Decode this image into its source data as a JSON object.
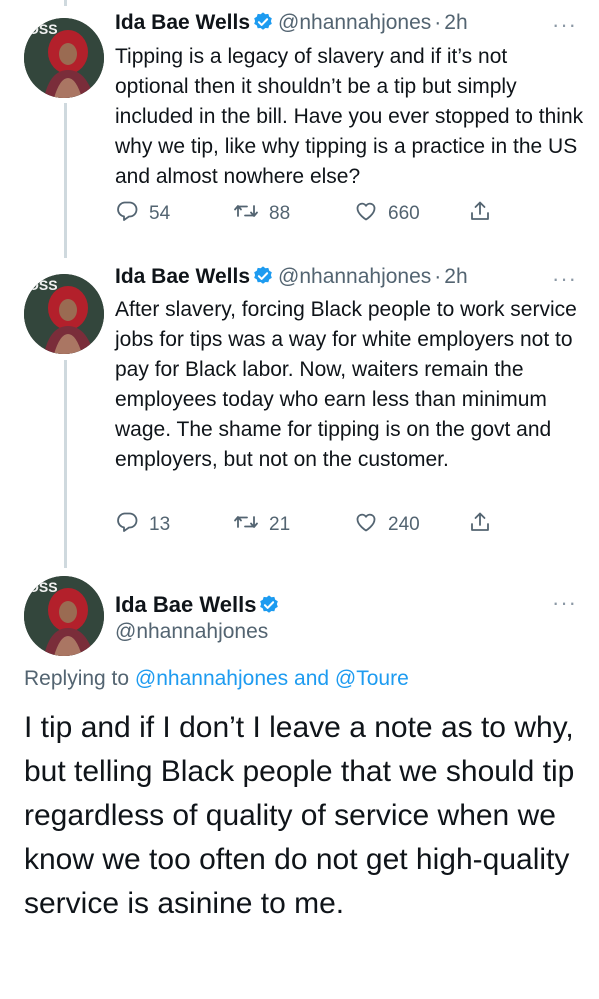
{
  "tweets": [
    {
      "name": "Ida Bae Wells",
      "handle": "@nhannahjones",
      "dot": "·",
      "time": "2h",
      "more": "···",
      "text": "Tipping is a legacy of slavery and if it’s not optional then it shouldn’t be a tip but simply included in the bill. Have you ever stopped to think why we tip, like why tipping is a practice in the US and almost nowhere else?",
      "replies": "54",
      "retweets": "88",
      "likes": "660"
    },
    {
      "name": "Ida Bae Wells",
      "handle": "@nhannahjones",
      "dot": "·",
      "time": "2h",
      "more": "···",
      "text": "After slavery, forcing Black people to work service jobs for tips was a way for white employers not to pay for Black labor. Now, waiters remain the employees today who earn less than minimum wage. The shame for tipping is on the govt and employers, but not on the customer.",
      "replies": "13",
      "retweets": "21",
      "likes": "240"
    }
  ],
  "main_tweet": {
    "name": "Ida Bae Wells",
    "handle": "@nhannahjones",
    "more": "···",
    "replying_prefix": "Replying to",
    "replying_user1": "@nhannahjones",
    "replying_and": "and",
    "replying_user2": "@Toure",
    "text": "I tip and if I don’t I leave a note as to why, but telling Black people that we should tip regardless of quality of service when we know we too often do not get high-quality service is asinine to me."
  },
  "colors": {
    "verified": "#1d9bf0",
    "link": "#1d9bf0",
    "secondary_text": "#536471",
    "thread_line": "#cfd9de"
  },
  "icons": [
    "verified-badge-icon",
    "reply-icon",
    "retweet-icon",
    "like-icon",
    "share-icon",
    "more-icon"
  ]
}
